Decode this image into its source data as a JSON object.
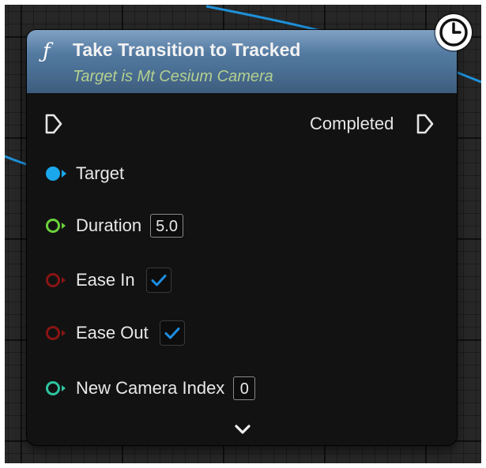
{
  "node": {
    "function_icon_glyph": "ƒ",
    "function_icon": "function-icon",
    "title": "Take Transition to Tracked",
    "subtitle": "Target is Mt Cesium Camera",
    "header_color": "#4d7399",
    "badge_icon": "clock-icon"
  },
  "exec": {
    "input_icon": "exec-pin-icon",
    "output_label": "Completed",
    "output_icon": "exec-pin-icon"
  },
  "pins": {
    "target": {
      "label": "Target",
      "color": "#1aa7ec",
      "type": "object-reference"
    },
    "duration": {
      "label": "Duration",
      "value": "5.0",
      "color": "#6bd13b",
      "type": "float"
    },
    "ease_in": {
      "label": "Ease In",
      "checked": true,
      "color": "#8a1414",
      "type": "bool"
    },
    "ease_out": {
      "label": "Ease Out",
      "checked": true,
      "color": "#8a1414",
      "type": "bool"
    },
    "new_camera_index": {
      "label": "New Camera Index",
      "value": "0",
      "color": "#2ec5a0",
      "type": "integer"
    }
  },
  "advanced_toggle_icon": "chevron-down-icon",
  "colors": {
    "canvas": "#272727",
    "node_body": "#121212",
    "wire": "#1e90d8",
    "checkbox_check": "#1e8fe6"
  }
}
